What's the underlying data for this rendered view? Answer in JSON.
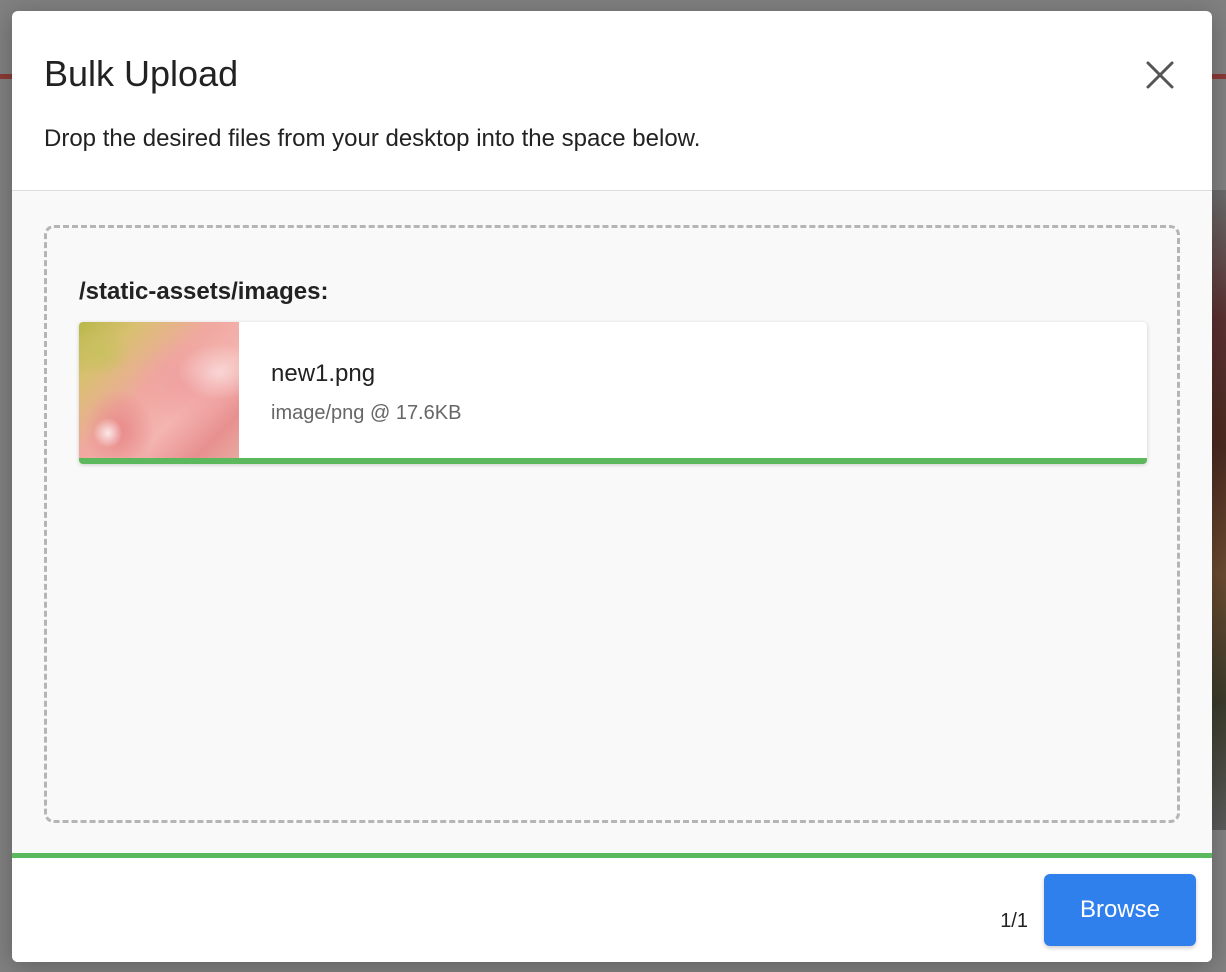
{
  "modal": {
    "title": "Bulk Upload",
    "subtitle": "Drop the desired files from your desktop into the space below."
  },
  "dropzone": {
    "folder_path": "/static-assets/images:",
    "files": [
      {
        "name": "new1.png",
        "meta": "image/png @ 17.6KB",
        "upload_progress": 1.0
      }
    ]
  },
  "overall_progress": 1.0,
  "footer": {
    "count": "1/1",
    "browse_label": "Browse"
  },
  "colors": {
    "accent": "#2f80ed",
    "progress": "#5cb85c"
  },
  "icons": {
    "close": "close-icon"
  }
}
